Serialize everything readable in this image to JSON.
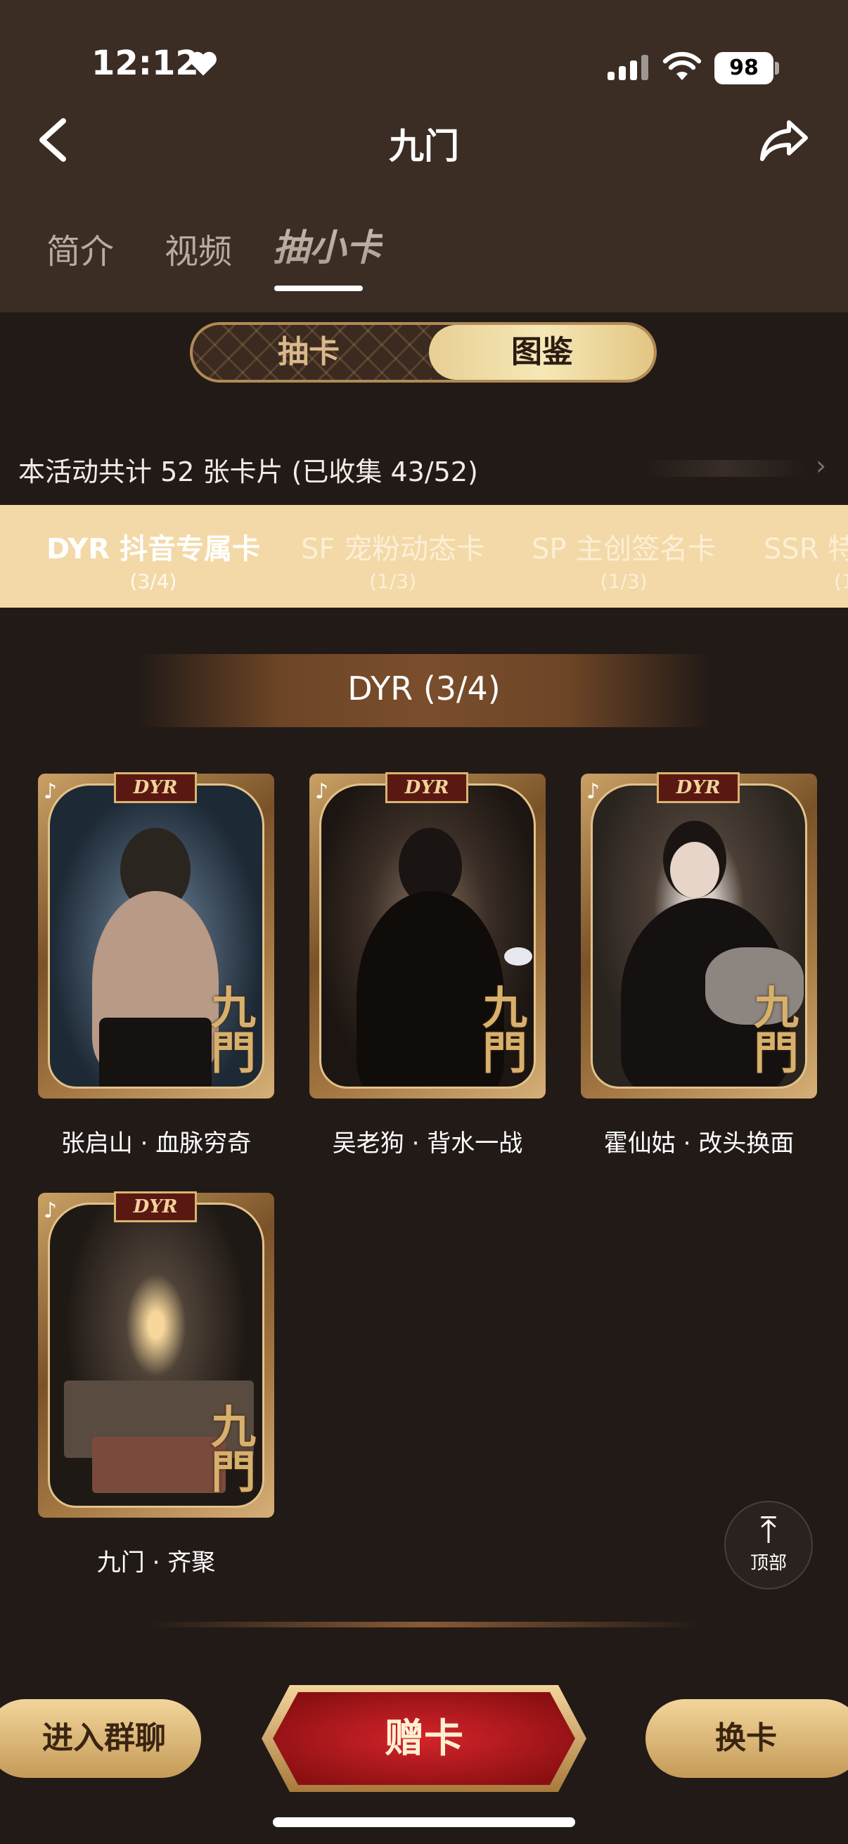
{
  "status_bar": {
    "time": "12:12",
    "battery": "98"
  },
  "header": {
    "title": "九门"
  },
  "tabs": [
    {
      "label": "简介"
    },
    {
      "label": "视频"
    },
    {
      "label": "抽小卡"
    }
  ],
  "toggle": {
    "left": "抽卡",
    "right": "图鉴"
  },
  "collection": {
    "summary": "本活动共计 52 张卡片 (已收集 43/52)"
  },
  "categories": [
    {
      "name": "DYR 抖音专属卡",
      "count": "(3/4)"
    },
    {
      "name": "SF 宠粉动态卡",
      "count": "(1/3)"
    },
    {
      "name": "SP 主创签名卡",
      "count": "(1/3)"
    },
    {
      "name": "SSR 特",
      "count": "(1"
    }
  ],
  "section": {
    "title": "DYR (3/4)"
  },
  "cards": [
    {
      "tag": "DYR",
      "caption": "张启山 · 血脉穷奇"
    },
    {
      "tag": "DYR",
      "caption": "吴老狗 · 背水一战"
    },
    {
      "tag": "DYR",
      "caption": "霍仙姑 · 改头换面"
    },
    {
      "tag": "DYR",
      "caption": "九门 · 齐聚"
    }
  ],
  "card_mark": "九門",
  "top_button": {
    "label": "顶部"
  },
  "bottom": {
    "left": "进入群聊",
    "center": "赠卡",
    "right": "换卡"
  },
  "colors": {
    "accent_gold": "#f3d9a7",
    "bg_dark": "#221a17",
    "header_bg": "#3b2c24",
    "gift_red": "#b3151a"
  },
  "icons": [
    "back-chevron-icon",
    "share-icon",
    "heart-icon",
    "signal-icon",
    "wifi-icon",
    "douyin-logo-icon",
    "arrow-up-icon"
  ]
}
